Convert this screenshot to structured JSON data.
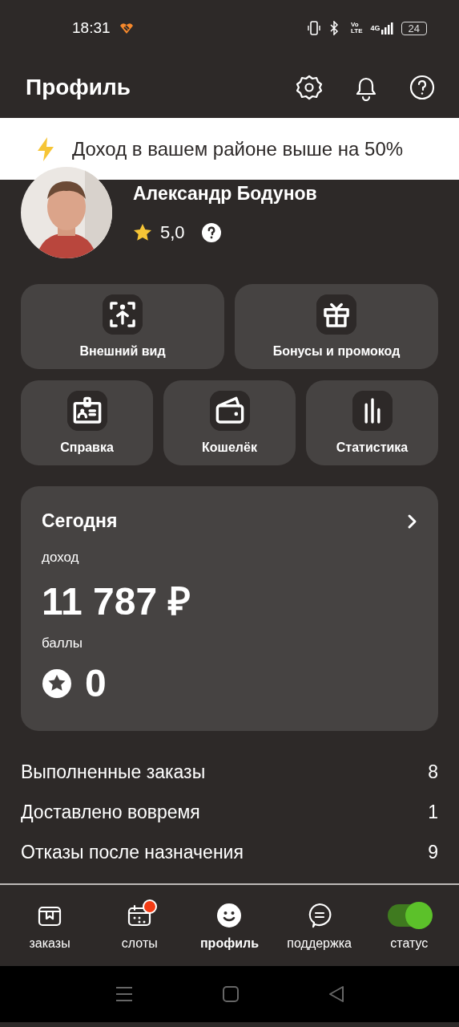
{
  "status_bar": {
    "time": "18:31",
    "network_volte_top": "Vo",
    "network_volte_bottom": "LTE",
    "network": "4G",
    "battery": "24"
  },
  "header": {
    "title": "Профиль"
  },
  "banner": {
    "text": "Доход в вашем районе выше на 50%"
  },
  "profile": {
    "name": "Александр Бодунов",
    "rating": "5,0"
  },
  "tiles": [
    {
      "label": "Внешний вид"
    },
    {
      "label": "Бонусы и промокод"
    },
    {
      "label": "Справка"
    },
    {
      "label": "Кошелёк"
    },
    {
      "label": "Статистика"
    }
  ],
  "today": {
    "title": "Сегодня",
    "income_label": "доход",
    "income": "11 787 ₽",
    "points_label": "баллы",
    "points": "0"
  },
  "stats": [
    {
      "label": "Выполненные заказы",
      "value": "8"
    },
    {
      "label": "Доставлено вовремя",
      "value": "1"
    },
    {
      "label": "Отказы после назначения",
      "value": "9"
    }
  ],
  "nav": [
    {
      "label": "заказы",
      "selected": false,
      "notification": false
    },
    {
      "label": "слоты",
      "selected": false,
      "notification": true
    },
    {
      "label": "профиль",
      "selected": true,
      "notification": false
    },
    {
      "label": "поддержка",
      "selected": false,
      "notification": false
    },
    {
      "label": "статус",
      "selected": false,
      "kind": "toggle",
      "on": true
    }
  ]
}
